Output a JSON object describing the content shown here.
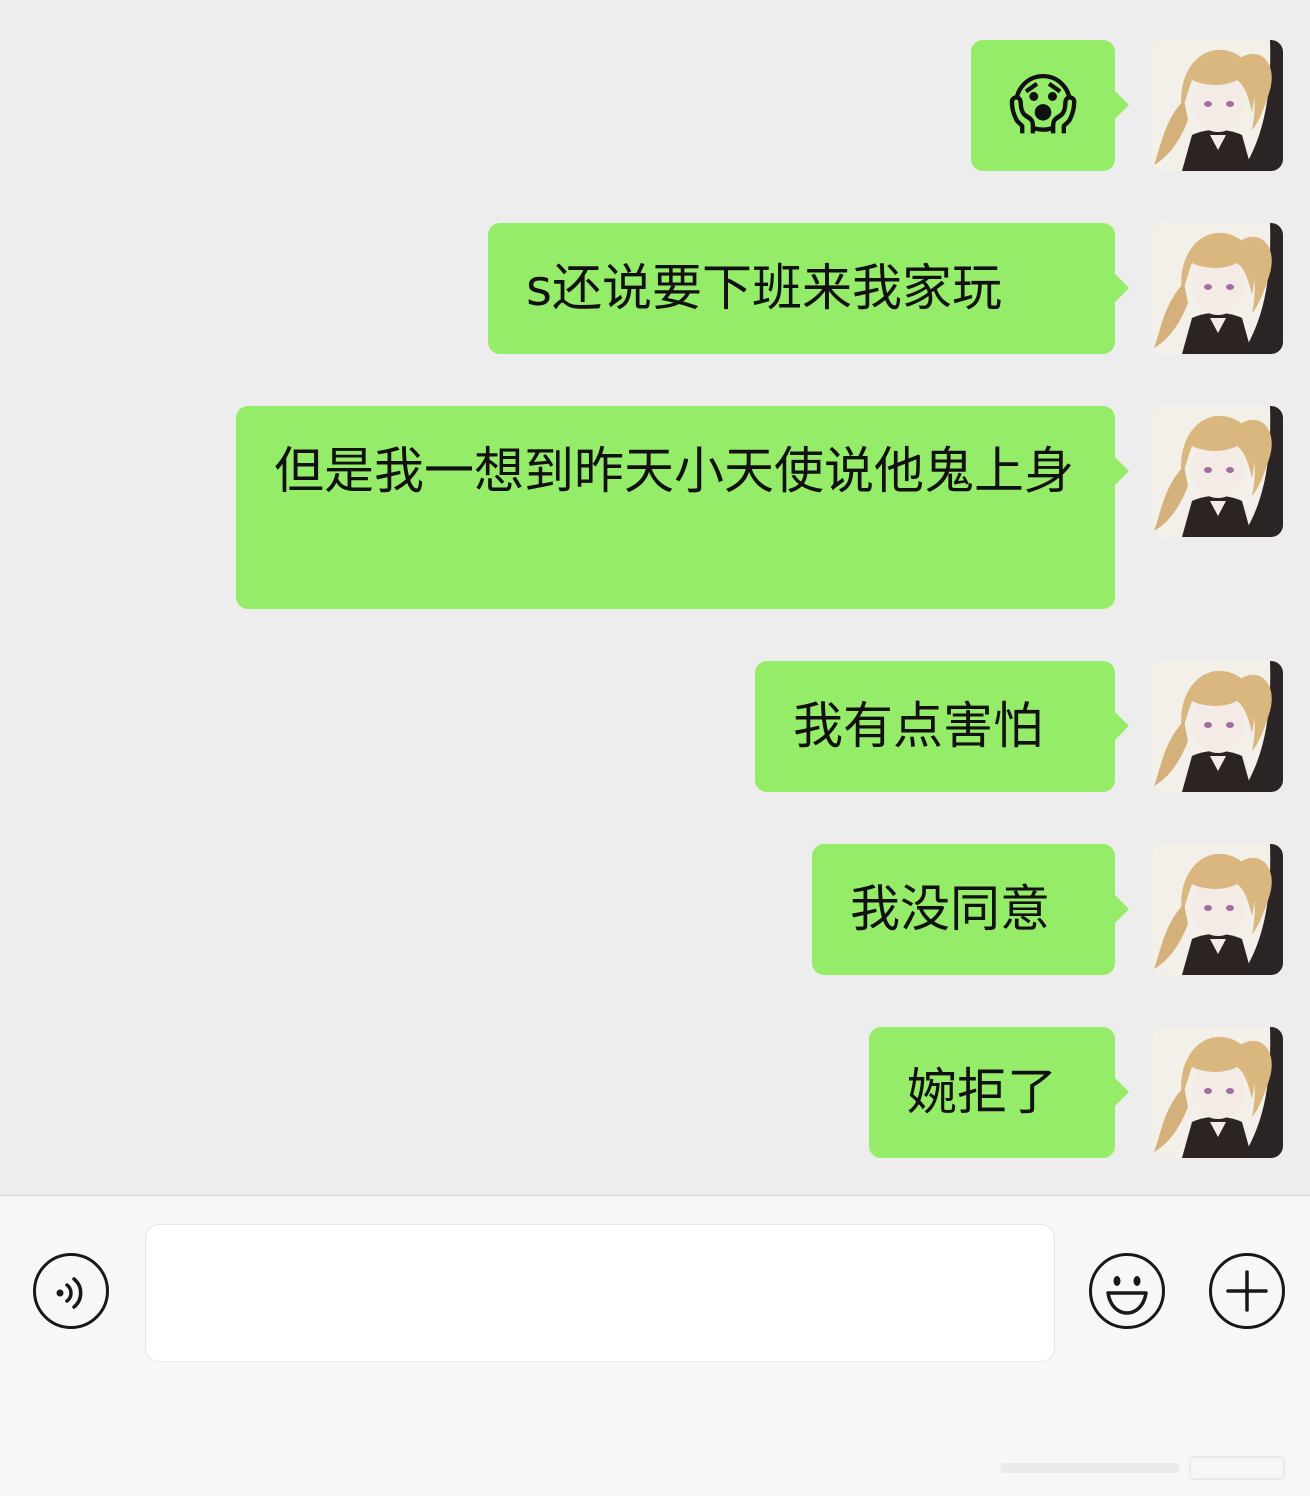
{
  "messages": [
    {
      "sender": "self",
      "type": "emoji",
      "emoji_name": "face-screaming-in-fear",
      "text": "😱"
    },
    {
      "sender": "self",
      "type": "text",
      "text": "s还说要下班来我家玩"
    },
    {
      "sender": "self",
      "type": "text",
      "text": "但是我一想到昨天小天使说他鬼上身"
    },
    {
      "sender": "self",
      "type": "text",
      "text": "我有点害怕"
    },
    {
      "sender": "self",
      "type": "text",
      "text": "我没同意"
    },
    {
      "sender": "self",
      "type": "text",
      "text": "婉拒了"
    }
  ],
  "avatar": {
    "icon": "anime-girl-avatar",
    "colors": {
      "hair": "#d9b77e",
      "outfit": "#2b2423",
      "skin": "#f4ebe6"
    }
  },
  "input_bar": {
    "voice_icon": "voice-toggle-icon",
    "input_value": "",
    "emoji_icon": "emoji-picker-icon",
    "plus_icon": "more-actions-icon"
  },
  "colors": {
    "background": "#ededed",
    "bubble_self": "#95ec69",
    "input_bar": "#f7f7f7"
  }
}
